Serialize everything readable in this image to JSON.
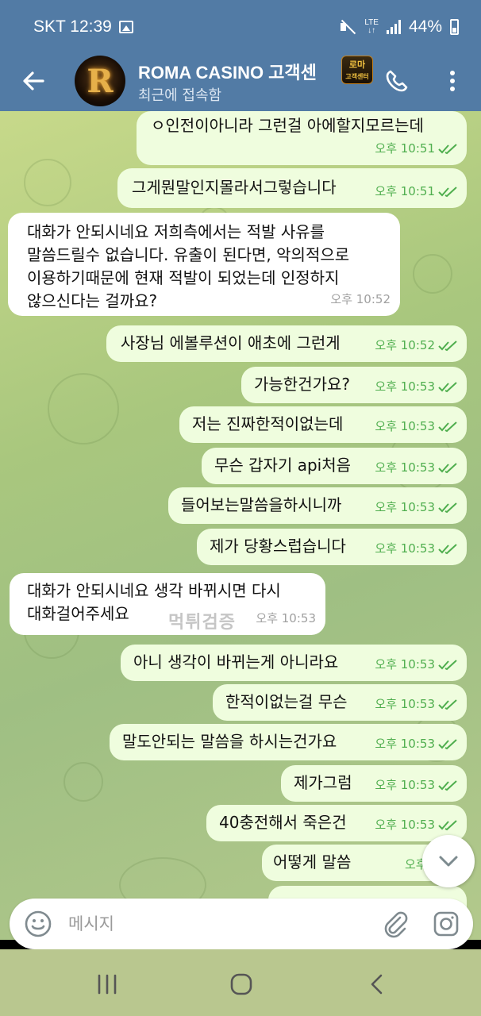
{
  "status": {
    "carrier_time": "SKT 12:39",
    "network": "LTE",
    "battery": "44%"
  },
  "header": {
    "title": "ROMA CASINO 고객센",
    "badge_line1": "로마",
    "badge_line2": "고객센터",
    "subtitle": "최근에 접속함",
    "avatar_letter": "R"
  },
  "messages": [
    {
      "dir": "out",
      "text": "ㅇ인전이아니라 그런걸 아에할지모르는데",
      "time": "오후 10:51",
      "read": true
    },
    {
      "dir": "out",
      "text": "그게뭔말인지몰라서그렇습니다",
      "time": "오후 10:51",
      "read": true
    },
    {
      "dir": "in",
      "lines": [
        "대화가 안되시네요 저희측에서는 적발 사유를",
        "말씀드릴수 없습니다. 유출이 된다면, 악의적으로",
        "이용하기때문에 현재 적발이 되었는데 인정하지",
        "않으신다는 걸까요?"
      ],
      "time": "오후 10:52"
    },
    {
      "dir": "out",
      "text": "사장님 에볼루션이 애초에 그런게",
      "time": "오후 10:52",
      "read": true
    },
    {
      "dir": "out",
      "text": "가능한건가요?",
      "time": "오후 10:53",
      "read": true
    },
    {
      "dir": "out",
      "text": "저는 진짜한적이없는데",
      "time": "오후 10:53",
      "read": true
    },
    {
      "dir": "out",
      "text": "무슨 갑자기 api처음",
      "time": "오후 10:53",
      "read": true
    },
    {
      "dir": "out",
      "text": "들어보는말씀을하시니까",
      "time": "오후 10:53",
      "read": true
    },
    {
      "dir": "out",
      "text": "제가 당황스럽습니다",
      "time": "오후 10:53",
      "read": true
    },
    {
      "dir": "in",
      "lines": [
        "대화가 안되시네요 생각 바뀌시면 다시",
        "대화걸어주세요"
      ],
      "time": "오후 10:53"
    },
    {
      "dir": "out",
      "text": "아니 생각이 바뀌는게 아니라요",
      "time": "오후 10:53",
      "read": true
    },
    {
      "dir": "out",
      "text": "한적이없는걸 무슨",
      "time": "오후 10:53",
      "read": true
    },
    {
      "dir": "out",
      "text": "말도안되는 말씀을 하시는건가요",
      "time": "오후 10:53",
      "read": true
    },
    {
      "dir": "out",
      "text": "제가그럼",
      "time": "오후 10:53",
      "read": true
    },
    {
      "dir": "out",
      "text": "40충전해서 죽은건",
      "time": "오후 10:53",
      "read": true
    },
    {
      "dir": "out",
      "text": "어떻게 말씀",
      "time": "오후 10:5",
      "read": true
    }
  ],
  "watermark": "먹튀검증",
  "input": {
    "placeholder": "메시지"
  },
  "icons": {
    "back": "arrow-left-icon",
    "call": "phone-icon",
    "menu": "more-vertical-icon",
    "emoji": "emoji-icon",
    "attach": "paperclip-icon",
    "camera": "instagram-camera-icon",
    "scroll": "chevron-down-icon"
  },
  "colors": {
    "header": "#527ba5",
    "outgoing_bubble": "#effdde",
    "incoming_bubble": "#ffffff",
    "check": "#4fae4e"
  }
}
